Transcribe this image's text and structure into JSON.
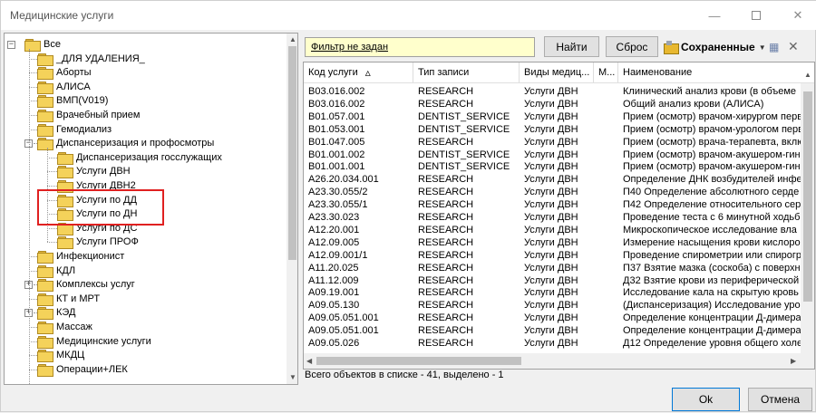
{
  "window": {
    "title": "Медицинские услуги",
    "min_glyph": "—",
    "close_glyph": "✕"
  },
  "tree": {
    "nodes": [
      {
        "label": "Все",
        "level": 0,
        "expand": "minus"
      },
      {
        "label": "_ДЛЯ УДАЛЕНИЯ_",
        "level": 1
      },
      {
        "label": "Аборты",
        "level": 1
      },
      {
        "label": "АЛИСА",
        "level": 1
      },
      {
        "label": "ВМП(V019)",
        "level": 1
      },
      {
        "label": "Врачебный прием",
        "level": 1
      },
      {
        "label": "Гемодиализ",
        "level": 1
      },
      {
        "label": "Диспансеризация и профосмотры",
        "level": 1,
        "expand": "minus"
      },
      {
        "label": "Диспансеризация госслужащих",
        "level": 2
      },
      {
        "label": "Услуги ДВН",
        "level": 2,
        "selected": true
      },
      {
        "label": "Услуги ДВН2",
        "level": 2
      },
      {
        "label": "Услуги по ДД",
        "level": 2
      },
      {
        "label": "Услуги по ДН",
        "level": 2
      },
      {
        "label": "Услуги по ДС",
        "level": 2
      },
      {
        "label": "Услуги ПРОФ",
        "level": 2
      },
      {
        "label": "Инфекционист",
        "level": 1
      },
      {
        "label": "КДЛ",
        "level": 1
      },
      {
        "label": "Комплексы услуг",
        "level": 1,
        "expand": "plus"
      },
      {
        "label": "КТ и МРТ",
        "level": 1
      },
      {
        "label": "КЭД",
        "level": 1,
        "expand": "plus"
      },
      {
        "label": "Массаж",
        "level": 1
      },
      {
        "label": "Медицинские услуги",
        "level": 1
      },
      {
        "label": "МКДЦ",
        "level": 1
      },
      {
        "label": "Операции+ЛЕК",
        "level": 1
      }
    ]
  },
  "toolbar": {
    "filter_text": "Фильтр не задан",
    "find_label": "Найти",
    "reset_label": "Сброс",
    "saved_label": "Сохраненные",
    "caret": "▼",
    "close_glyph": "✕",
    "columns_glyph": "▦"
  },
  "grid": {
    "columns": [
      "Код услуги",
      "Тип записи",
      "Виды медиц...",
      "М...",
      "Наименование"
    ],
    "sort_glyph": "▵",
    "rows": [
      [
        "B03.016.002",
        "RESEARCH",
        "Услуги ДВН",
        "Клинический анализ крови (в объеме"
      ],
      [
        "B03.016.002",
        "RESEARCH",
        "Услуги ДВН",
        "Общий анализ крови (АЛИСА)"
      ],
      [
        "B01.057.001",
        "DENTIST_SERVICE",
        "Услуги ДВН",
        "Прием (осмотр) врачом-хирургом перв"
      ],
      [
        "B01.053.001",
        "DENTIST_SERVICE",
        "Услуги ДВН",
        "Прием (осмотр) врачом-урологом перв"
      ],
      [
        "B01.047.005",
        "RESEARCH",
        "Услуги ДВН",
        "Прием (осмотр) врача-терапевта, вклю"
      ],
      [
        "B01.001.002",
        "DENTIST_SERVICE",
        "Услуги ДВН",
        "Прием (осмотр) врачом-акушером-гин"
      ],
      [
        "B01.001.001",
        "DENTIST_SERVICE",
        "Услуги ДВН",
        "Прием (осмотр) врачом-акушером-гин"
      ],
      [
        "A26.20.034.001",
        "RESEARCH",
        "Услуги ДВН",
        "Определение ДНК возбудителей инфе"
      ],
      [
        "A23.30.055/2",
        "RESEARCH",
        "Услуги ДВН",
        "П40 Определение абсолютного серде"
      ],
      [
        "A23.30.055/1",
        "RESEARCH",
        "Услуги ДВН",
        "П42 Определение относительного серд"
      ],
      [
        "A23.30.023",
        "RESEARCH",
        "Услуги ДВН",
        "Проведение теста с 6 минутной ходьб"
      ],
      [
        "A12.20.001",
        "RESEARCH",
        "Услуги ДВН",
        "Микроскопическое исследование вла"
      ],
      [
        "A12.09.005",
        "RESEARCH",
        "Услуги ДВН",
        "Измерение насыщения крови кислоро"
      ],
      [
        "A12.09.001/1",
        "RESEARCH",
        "Услуги ДВН",
        "Проведение спирометрии или спирогр"
      ],
      [
        "A11.20.025",
        "RESEARCH",
        "Услуги ДВН",
        "П37 Взятие мазка (соскоба) с поверхн"
      ],
      [
        "A11.12.009",
        "RESEARCH",
        "Услуги ДВН",
        "Д32 Взятие крови из периферической"
      ],
      [
        "A09.19.001",
        "RESEARCH",
        "Услуги ДВН",
        "Исследование кала на скрытую кровь"
      ],
      [
        "A09.05.130",
        "RESEARCH",
        "Услуги ДВН",
        "(Диспансеризация) Исследование уро"
      ],
      [
        "A09.05.051.001",
        "RESEARCH",
        "Услуги ДВН",
        "Определение концентрации Д-димера"
      ],
      [
        "A09.05.051.001",
        "RESEARCH",
        "Услуги ДВН",
        "Определение концентрации Д-димера"
      ],
      [
        "A09.05.026",
        "RESEARCH",
        "Услуги ДВН",
        "Д12 Определение уровня общего холе"
      ]
    ]
  },
  "status": "Всего объектов в списке - 41, выделено - 1",
  "buttons": {
    "ok": "Ok",
    "cancel": "Отмена"
  },
  "colors": {
    "filter_bg": "#ffffcc",
    "highlight_border": "#e02020",
    "folder": "#f4d25a"
  }
}
